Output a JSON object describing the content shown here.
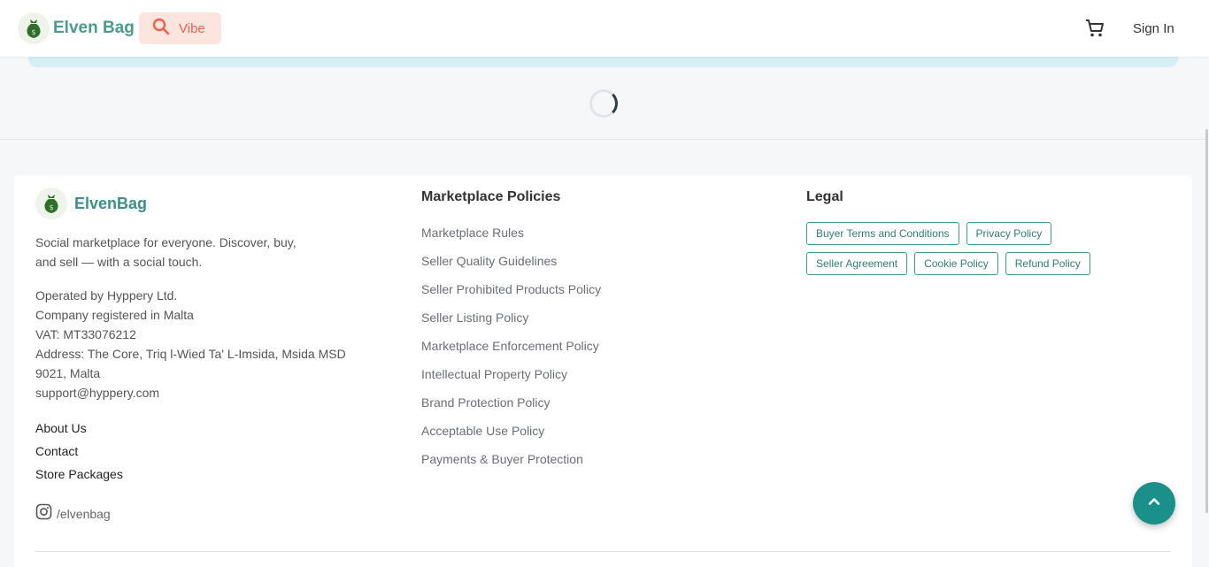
{
  "header": {
    "brand": "Elven Bag",
    "vibe_label": "Vibe",
    "signin_label": "Sign In"
  },
  "colors": {
    "brand_teal": "#4a9a8e",
    "vibe_accent": "#f2604a",
    "fab": "#1b8f8a"
  },
  "icons": {
    "logo": "money-bag-icon",
    "vibe": "search-icon",
    "cart": "shopping-cart-icon",
    "instagram": "instagram-icon",
    "fab": "chevron-up-icon"
  },
  "footer": {
    "brand": "ElvenBag",
    "tagline": "Social marketplace for everyone. Discover, buy, and sell — with a social touch.",
    "company": {
      "operated": "Operated by Hyppery Ltd.",
      "registered": "Company registered in Malta",
      "vat": "VAT: MT33076212",
      "address": "Address: The Core, Triq l-Wied Ta' L-Imsida, Msida MSD 9021, Malta",
      "email": "support@hyppery.com"
    },
    "links": [
      "About Us",
      "Contact",
      "Store Packages"
    ],
    "instagram": "/elvenbag",
    "policies_title": "Marketplace Policies",
    "policies": [
      "Marketplace Rules",
      "Seller Quality Guidelines",
      "Seller Prohibited Products Policy",
      "Seller Listing Policy",
      "Marketplace Enforcement Policy",
      "Intellectual Property Policy",
      "Brand Protection Policy",
      "Acceptable Use Policy",
      "Payments & Buyer Protection"
    ],
    "legal_title": "Legal",
    "legal": [
      "Buyer Terms and Conditions",
      "Privacy Policy",
      "Seller Agreement",
      "Cookie Policy",
      "Refund Policy"
    ]
  }
}
